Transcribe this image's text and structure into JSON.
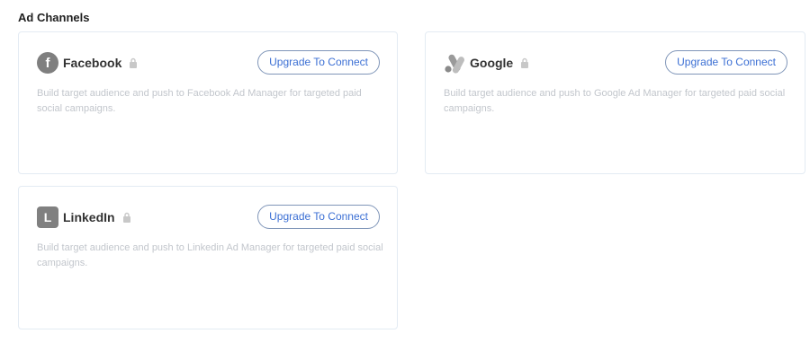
{
  "section": {
    "title": "Ad Channels"
  },
  "channels": [
    {
      "name": "Facebook",
      "logo_letter": "f",
      "button_label": "Upgrade To Connect",
      "description": "Build target audience and push to Facebook Ad Manager for targeted paid social campaigns."
    },
    {
      "name": "Google",
      "logo_letter": "",
      "button_label": "Upgrade To Connect",
      "description": "Build target audience and push to Google Ad Manager for targeted paid social campaigns."
    },
    {
      "name": "LinkedIn",
      "logo_letter": "L",
      "button_label": "Upgrade To Connect",
      "description": "Build target audience and push to Linkedin Ad Manager for targeted paid social campaigns."
    }
  ],
  "colors": {
    "accent": "#3b6fd4",
    "card_border": "#e3ebf3",
    "logo_gray": "#808080",
    "muted_text": "#c2c6cc"
  },
  "icons": {
    "lock": "lock-icon",
    "facebook": "facebook-logo-icon",
    "google": "google-ads-logo-icon",
    "linkedin": "linkedin-logo-icon"
  }
}
